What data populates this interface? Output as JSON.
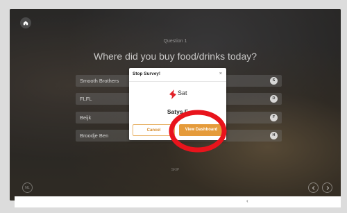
{
  "survey": {
    "question_number": "Question 1",
    "question": "Where did you buy food/drinks today?",
    "options": [
      {
        "label": "Smooth Brothers",
        "key": "S"
      },
      {
        "label": "FLFL",
        "key": "D"
      },
      {
        "label": "Beijk",
        "key": "F"
      },
      {
        "label": "Broodje Ben",
        "key": "H"
      }
    ],
    "skip_label": "SKIP",
    "language_badge": "NL"
  },
  "modal": {
    "title": "Stop Survey!",
    "close": "×",
    "logo_text": "Sat",
    "brand_name": "Satys F",
    "cancel_label": "Cancel",
    "view_dashboard_label": "View Dashboard"
  },
  "bottom_bar": {
    "back_glyph": "‹"
  },
  "colors": {
    "accent": "#e59b3b",
    "logo_red": "#e2232a",
    "annotation": "#e8141c"
  },
  "icons": [
    "home-icon",
    "chevron-left-icon",
    "chevron-right-icon",
    "close-icon",
    "satys-logo-icon"
  ]
}
